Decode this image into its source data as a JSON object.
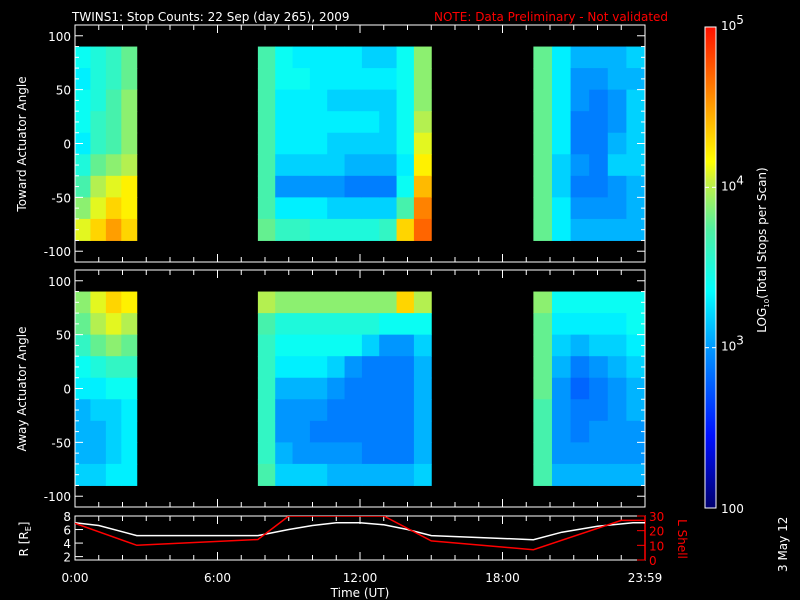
{
  "title": {
    "main": "TWINS1: Stop Counts: 22 Sep (day 265), 2009",
    "note": "NOTE: Data Preliminary - Not validated"
  },
  "date_stamp": "3 May 12",
  "chart_data": [
    {
      "type": "heatmap",
      "name": "toward",
      "ylabel": "Toward Actuator Angle",
      "ylim": [
        -110,
        110
      ],
      "yticks": [
        100,
        50,
        0,
        -50,
        -100
      ],
      "angle_bins": [
        90,
        70,
        50,
        30,
        10,
        -10,
        -30,
        -50,
        -70,
        -90
      ],
      "units": "log10 counts",
      "blocks": [
        {
          "t0": 0,
          "t1": 2.6,
          "cols": [
            [
              3.4,
              3.3,
              3.4,
              3.4,
              3.3,
              3.5,
              3.7,
              3.9,
              4.1
            ],
            [
              3.5,
              3.5,
              3.5,
              3.6,
              3.6,
              3.8,
              4.0,
              4.1,
              4.3
            ],
            [
              3.6,
              3.6,
              3.7,
              3.7,
              3.7,
              3.9,
              4.1,
              4.3,
              4.5
            ],
            [
              3.8,
              3.8,
              3.9,
              3.9,
              3.9,
              4.0,
              4.2,
              4.2,
              4.3
            ]
          ]
        },
        {
          "t0": 7.7,
          "t1": 15.0,
          "cols": [
            [
              3.7,
              3.7,
              3.7,
              3.7,
              3.7,
              3.7,
              3.7,
              3.7,
              3.8
            ],
            [
              3.4,
              3.4,
              3.3,
              3.3,
              3.3,
              3.2,
              3.0,
              3.3,
              3.6
            ],
            [
              3.3,
              3.4,
              3.3,
              3.3,
              3.3,
              3.2,
              3.0,
              3.3,
              3.6
            ],
            [
              3.3,
              3.3,
              3.3,
              3.3,
              3.3,
              3.2,
              3.0,
              3.3,
              3.5
            ],
            [
              3.3,
              3.3,
              3.2,
              3.3,
              3.2,
              3.2,
              3.0,
              3.2,
              3.5
            ],
            [
              3.3,
              3.3,
              3.2,
              3.3,
              3.2,
              3.1,
              2.9,
              3.2,
              3.5
            ],
            [
              3.2,
              3.3,
              3.2,
              3.3,
              3.2,
              3.1,
              2.9,
              3.2,
              3.5
            ],
            [
              3.2,
              3.3,
              3.2,
              3.2,
              3.2,
              3.1,
              2.9,
              3.2,
              3.6
            ],
            [
              3.4,
              3.4,
              3.4,
              3.4,
              3.4,
              3.3,
              3.4,
              3.7,
              4.3
            ],
            [
              3.9,
              3.9,
              3.9,
              4.0,
              4.1,
              4.2,
              4.4,
              4.6,
              4.7
            ]
          ]
        },
        {
          "t0": 19.3,
          "t1": 24.0,
          "cols": [
            [
              3.8,
              3.8,
              3.8,
              3.8,
              3.8,
              3.8,
              3.8,
              3.8,
              3.8
            ],
            [
              3.3,
              3.3,
              3.3,
              3.3,
              3.3,
              3.2,
              3.2,
              3.3,
              3.3
            ],
            [
              3.1,
              3.0,
              3.0,
              2.9,
              2.9,
              3.0,
              2.9,
              3.0,
              3.1
            ],
            [
              3.1,
              3.0,
              2.9,
              2.9,
              2.9,
              2.9,
              2.9,
              3.0,
              3.1
            ],
            [
              3.1,
              3.1,
              3.0,
              3.0,
              3.1,
              3.2,
              3.0,
              3.0,
              3.1
            ],
            [
              3.2,
              3.1,
              3.2,
              3.2,
              3.2,
              3.2,
              3.1,
              3.1,
              3.1
            ]
          ]
        }
      ]
    },
    {
      "type": "heatmap",
      "name": "away",
      "ylabel": "Away Actuator Angle",
      "ylim": [
        -110,
        110
      ],
      "yticks": [
        100,
        50,
        0,
        -50,
        -100
      ],
      "angle_bins": [
        90,
        70,
        50,
        30,
        10,
        -10,
        -30,
        -50,
        -70,
        -90
      ],
      "units": "log10 counts",
      "blocks": [
        {
          "t0": 0,
          "t1": 2.6,
          "cols": [
            [
              3.9,
              3.8,
              3.6,
              3.4,
              3.3,
              3.1,
              3.1,
              3.1,
              3.2
            ],
            [
              4.1,
              4.0,
              3.8,
              3.5,
              3.3,
              3.2,
              3.1,
              3.1,
              3.2
            ],
            [
              4.3,
              4.1,
              3.9,
              3.6,
              3.4,
              3.2,
              3.2,
              3.2,
              3.3
            ],
            [
              4.2,
              4.0,
              3.8,
              3.6,
              3.4,
              3.3,
              3.3,
              3.3,
              3.3
            ]
          ]
        },
        {
          "t0": 7.7,
          "t1": 15.0,
          "cols": [
            [
              4.0,
              3.7,
              3.6,
              3.6,
              3.6,
              3.6,
              3.6,
              3.6,
              3.7
            ],
            [
              3.9,
              3.5,
              3.4,
              3.3,
              3.1,
              3.0,
              3.0,
              3.1,
              3.2
            ],
            [
              3.9,
              3.5,
              3.4,
              3.3,
              3.1,
              3.0,
              3.0,
              3.0,
              3.2
            ],
            [
              3.9,
              3.5,
              3.4,
              3.3,
              3.1,
              3.0,
              2.9,
              3.0,
              3.2
            ],
            [
              3.9,
              3.5,
              3.4,
              3.2,
              3.0,
              2.9,
              2.9,
              3.0,
              3.1
            ],
            [
              3.9,
              3.5,
              3.4,
              3.0,
              2.9,
              2.9,
              2.9,
              3.0,
              3.1
            ],
            [
              3.9,
              3.5,
              3.2,
              2.9,
              2.9,
              2.9,
              2.9,
              2.9,
              3.1
            ],
            [
              3.9,
              3.4,
              3.0,
              2.9,
              2.9,
              2.9,
              2.9,
              2.9,
              3.1
            ],
            [
              4.3,
              3.4,
              3.0,
              2.9,
              2.9,
              2.9,
              2.9,
              2.9,
              3.1
            ],
            [
              4.0,
              3.4,
              3.2,
              3.1,
              3.1,
              3.1,
              3.1,
              3.1,
              3.2
            ]
          ]
        },
        {
          "t0": 19.3,
          "t1": 24.0,
          "cols": [
            [
              3.9,
              3.8,
              3.8,
              3.8,
              3.8,
              3.7,
              3.7,
              3.7,
              3.7
            ],
            [
              3.4,
              3.3,
              3.2,
              3.1,
              3.0,
              3.0,
              3.0,
              3.0,
              3.1
            ],
            [
              3.4,
              3.3,
              3.1,
              2.9,
              2.8,
              2.9,
              2.9,
              3.0,
              3.1
            ],
            [
              3.4,
              3.3,
              3.2,
              3.0,
              2.9,
              2.9,
              3.0,
              3.0,
              3.1
            ],
            [
              3.4,
              3.3,
              3.2,
              3.1,
              3.0,
              3.0,
              3.0,
              3.0,
              3.1
            ],
            [
              3.4,
              3.4,
              3.3,
              3.2,
              3.1,
              3.1,
              3.0,
              3.0,
              3.1
            ]
          ]
        }
      ]
    },
    {
      "type": "line",
      "name": "orbit",
      "xlabel": "Time (UT)",
      "xticks": [
        0,
        6,
        12,
        18,
        24
      ],
      "xticklabels": [
        "0:00",
        "6:00",
        "12:00",
        "18:00",
        "23:59"
      ],
      "xlim": [
        0,
        24
      ],
      "ylabel": "R [R",
      "ylabel_sub": "E",
      "ylabel_end": "]",
      "ylim": [
        1.5,
        8
      ],
      "yticks": [
        2,
        4,
        6,
        8
      ],
      "y2label": "L Shell",
      "y2lim": [
        0,
        30
      ],
      "y2ticks": [
        0,
        10,
        20,
        30
      ],
      "series": [
        {
          "name": "R",
          "color": "#ffffff",
          "axis": "left",
          "x": [
            0,
            1,
            2.6,
            7.7,
            9,
            10,
            11,
            12,
            13,
            14,
            15,
            19.3,
            20.5,
            22,
            23.5,
            24
          ],
          "y": [
            7.0,
            6.6,
            5.1,
            5.1,
            6.0,
            6.6,
            7.0,
            7.0,
            6.7,
            6.0,
            5.1,
            4.5,
            5.6,
            6.5,
            7.0,
            7.0
          ]
        },
        {
          "name": "L Shell",
          "color": "#ff0000",
          "axis": "right",
          "x": [
            0,
            2.6,
            7.7,
            9,
            13,
            15,
            19.3,
            23,
            24
          ],
          "y": [
            25,
            10,
            14,
            30,
            30,
            13,
            7,
            27,
            27
          ]
        }
      ]
    },
    {
      "type": "colorbar",
      "label": "LOG",
      "label_sub": "10",
      "label_rest": "(Total Stops per Scan)",
      "range_log10": [
        2,
        5
      ],
      "ticks": [
        {
          "value": 5,
          "base": "10",
          "exp": "5"
        },
        {
          "value": 4,
          "base": "10",
          "exp": "4"
        },
        {
          "value": 3,
          "base": "10",
          "exp": "3"
        },
        {
          "value": 2,
          "base": "100",
          "exp": ""
        }
      ]
    }
  ]
}
